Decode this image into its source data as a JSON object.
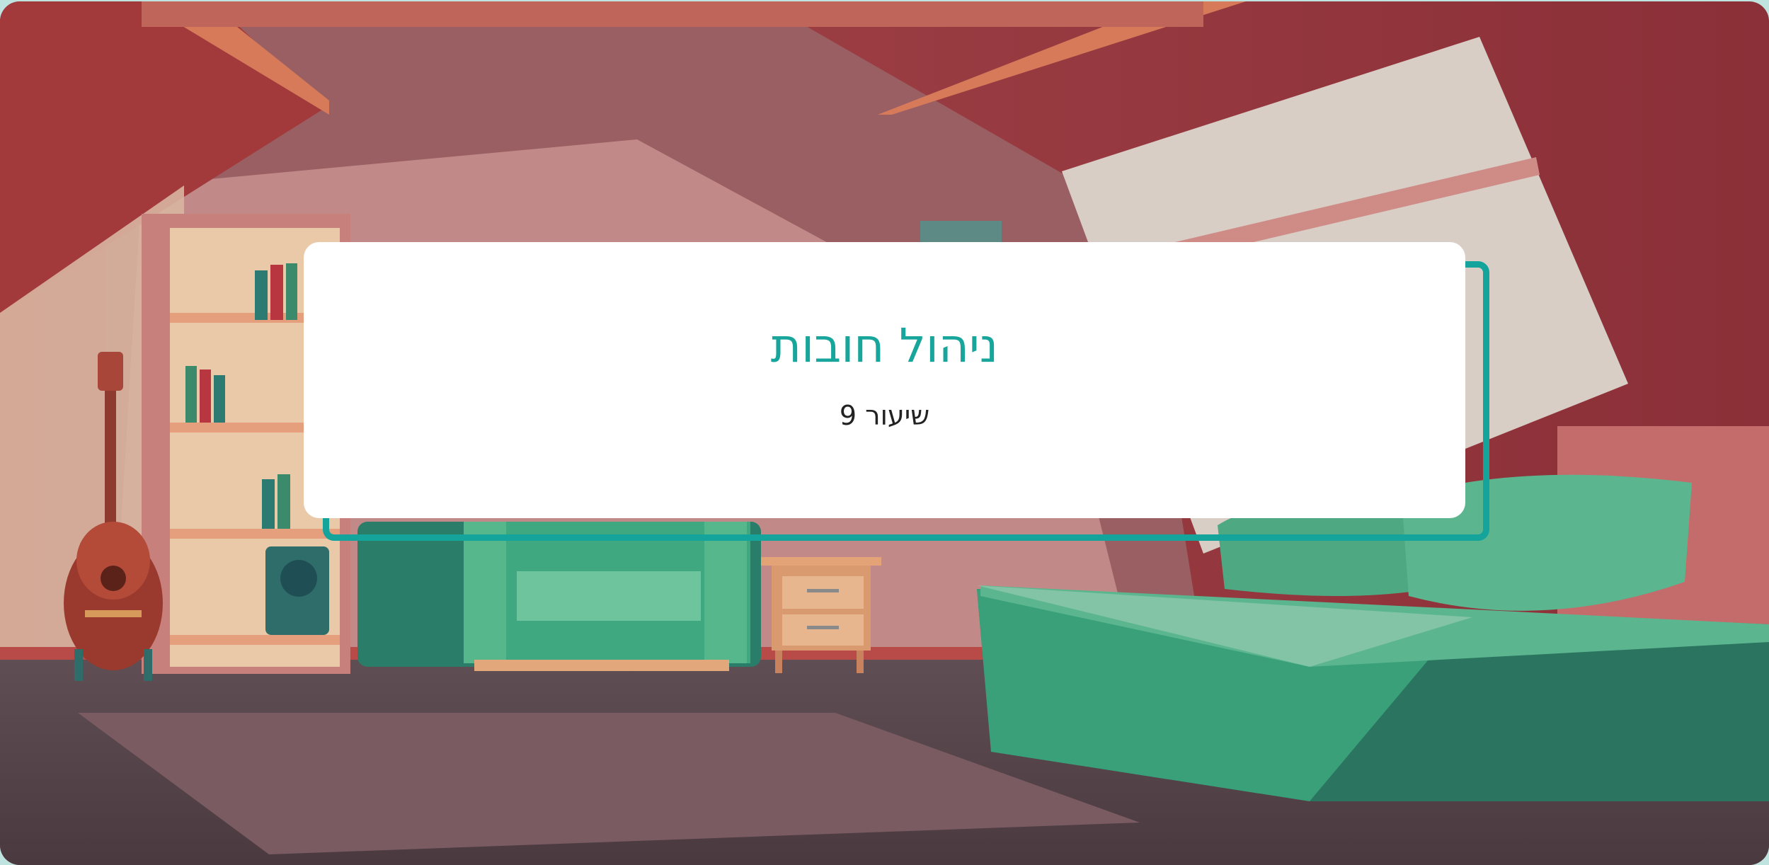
{
  "slide": {
    "title": "ניהול חובות",
    "subtitle": "שיעור 9"
  },
  "background": {
    "scene": "attic-room-illustration",
    "objects": [
      "roof-beams",
      "skylight-window",
      "bookshelf",
      "acoustic-guitar",
      "speaker",
      "armchair",
      "nightstand",
      "bed",
      "rug"
    ]
  },
  "colors": {
    "accent": "#14a49b",
    "title_text": "#17a59c",
    "subtitle_text": "#222222",
    "card": "#ffffff",
    "wall": "#8f3138",
    "furniture_green": "#2f9e76"
  }
}
